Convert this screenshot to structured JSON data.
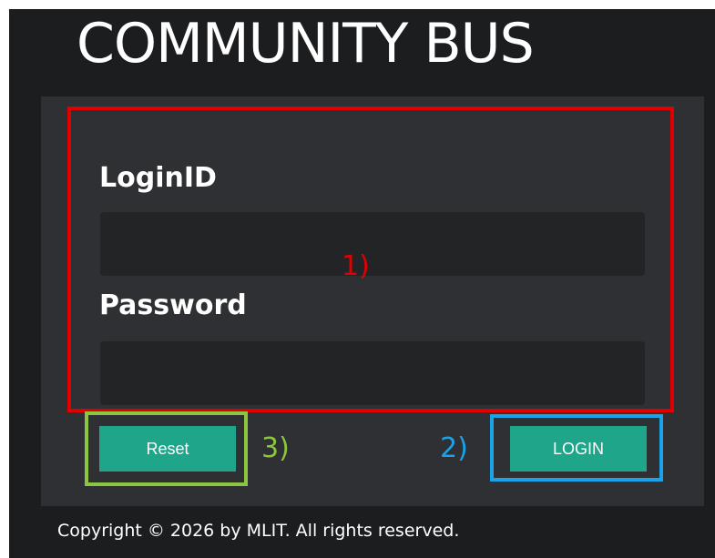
{
  "app_title": "COMMUNITY BUS",
  "login_form": {
    "login_id_label": "LoginID",
    "login_id_value": "",
    "password_label": "Password",
    "password_value": ""
  },
  "buttons": {
    "reset_label": "Reset",
    "login_label": "LOGIN"
  },
  "annotations": [
    {
      "label": "1)",
      "color": "#e00000"
    },
    {
      "label": "2)",
      "color": "#1aa3e8"
    },
    {
      "label": "3)",
      "color": "#8cc63f"
    }
  ],
  "footer": {
    "copyright": "Copyright © 2026 by MLIT. All rights reserved."
  },
  "colors": {
    "background": "#1c1d1f",
    "panel": "#2f3033",
    "input": "#232426",
    "button": "#1fa58a"
  }
}
